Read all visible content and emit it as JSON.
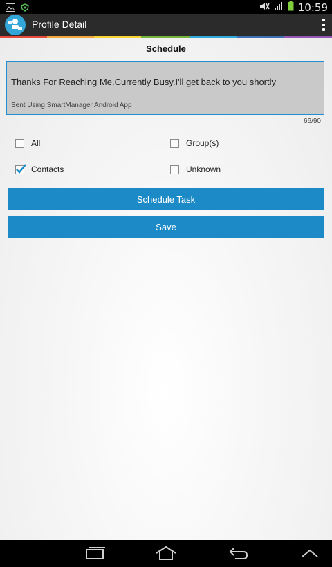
{
  "status": {
    "clock": "10:59",
    "icons": [
      "image-icon",
      "wifi-shield-icon",
      "mute-icon",
      "signal-icon",
      "battery-icon"
    ]
  },
  "app": {
    "title": "Profile Detail",
    "icon": "app-people-icon",
    "overflow_icon": "overflow-menu-icon",
    "strip_colors": [
      "#e64a3c",
      "#f1a73b",
      "#f7d334",
      "#74b33c",
      "#31a9d8",
      "#3e6fb3",
      "#9457b4"
    ]
  },
  "page": {
    "title": "Schedule",
    "message": "Thanks For Reaching Me.Currently Busy.I'll get back to you shortly",
    "signature": "Sent Using SmartManager Android App",
    "counter": "66/90",
    "options": {
      "all": {
        "label": "All",
        "checked": false
      },
      "groups": {
        "label": "Group(s)",
        "checked": false
      },
      "contacts": {
        "label": "Contacts",
        "checked": true
      },
      "unknown": {
        "label": "Unknown",
        "checked": false
      }
    },
    "buttons": {
      "schedule": "Schedule Task",
      "save": "Save"
    },
    "accent": "#1b8ac6"
  },
  "nav": {
    "icons": [
      "recent-apps-icon",
      "home-icon",
      "back-icon",
      "chevron-up-icon"
    ]
  }
}
